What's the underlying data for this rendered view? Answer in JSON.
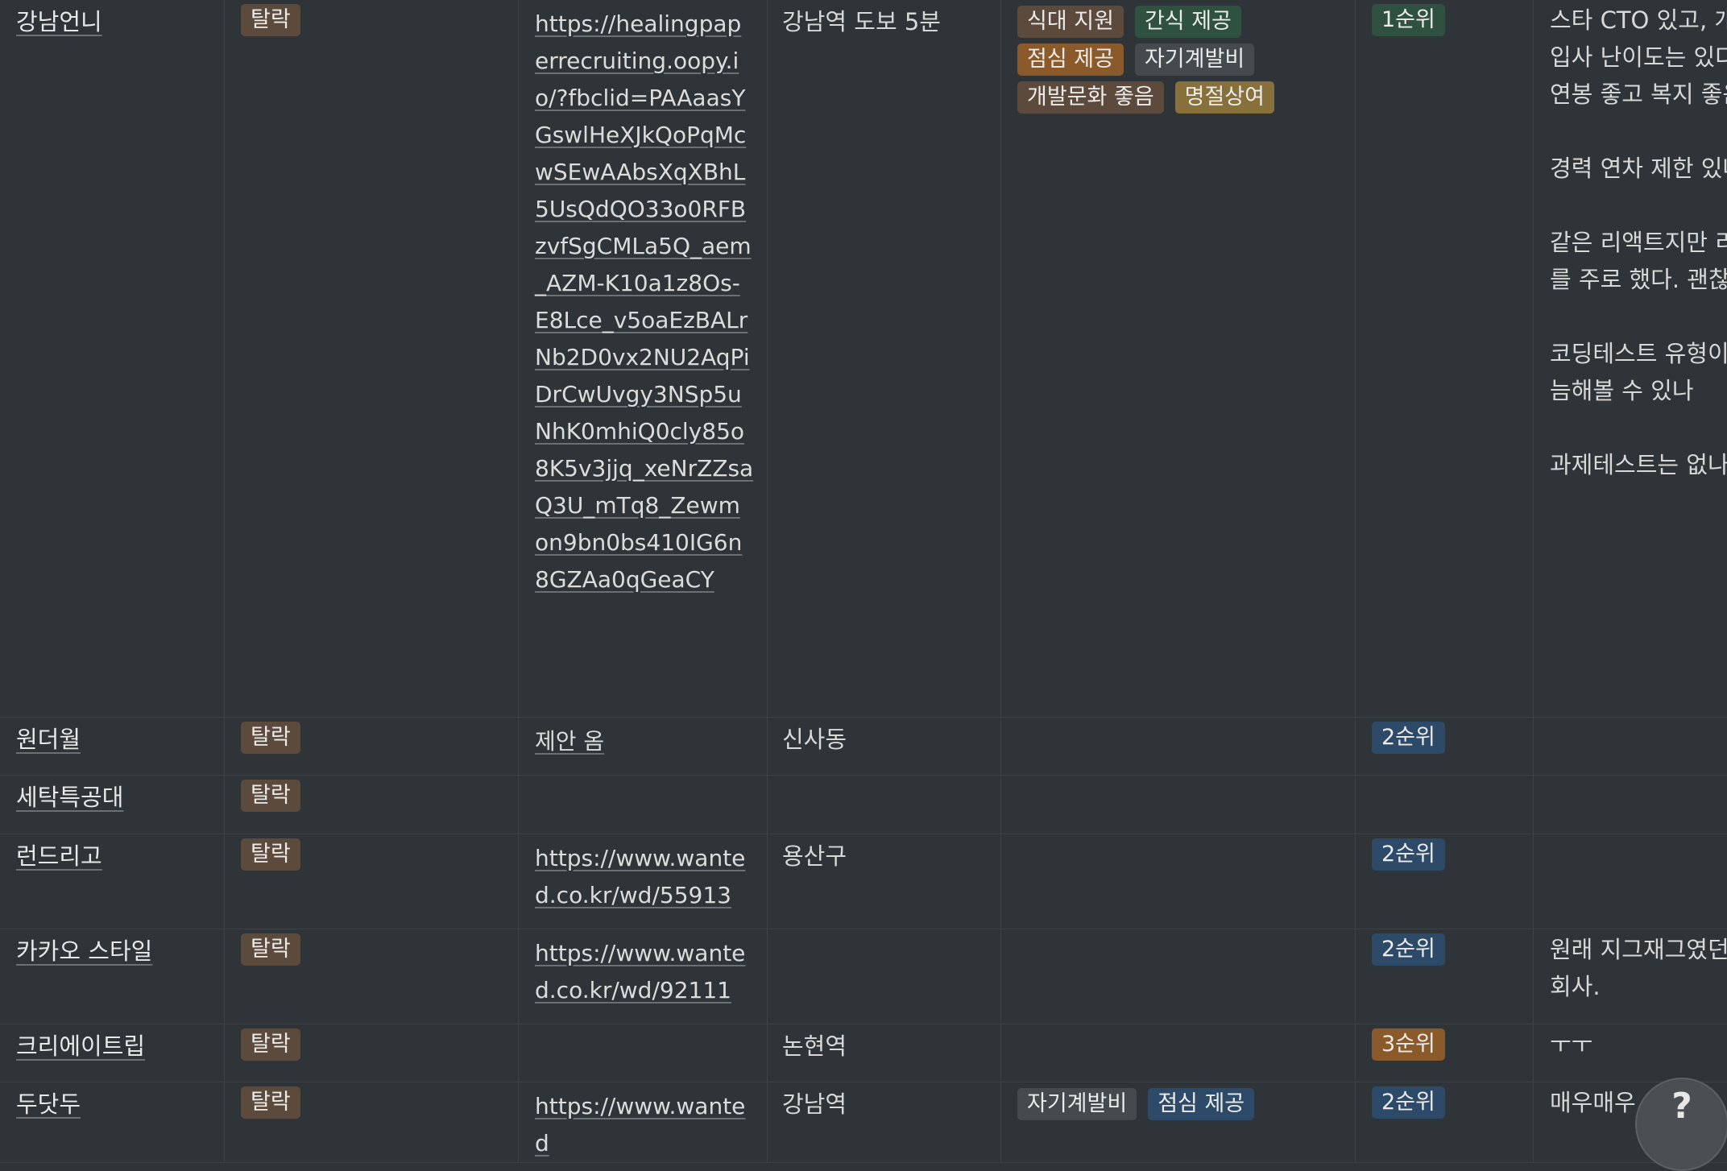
{
  "rows": [
    {
      "company": "강남언니",
      "status": {
        "label": "탈락",
        "color": "#5c4a3d"
      },
      "link": "https://healingpaperrecruiting.oopy.io/?fbclid=PAAaasYGswlHeXJkQoPqMcwSEwAAbsXqXBhL5UsQdQO33o0RFBzvfSgCMLa5Q_aem_AZM-K10a1z8Os-E8Lce_v5oaEzBALrNb2D0vx2NU2AqPiDrCwUvgy3NSp5uNhK0mhiQ0cly85o8K5v3jjq_xeNrZZsaQ3U_mTq8_Zewmon9bn0bs410IG6n8GZAa0qGeaCY",
      "location": "강남역 도보 5분",
      "benefits": [
        {
          "label": "식대 지원",
          "color": "#5c4a3d"
        },
        {
          "label": "간식 제공",
          "color": "#2f5140"
        },
        {
          "label": "점심 제공",
          "color": "#8a5a2b"
        },
        {
          "label": "자기계발비",
          "color": "#454a4e"
        },
        {
          "label": "개발문화 좋음",
          "color": "#5c4a3d"
        },
        {
          "label": "명절상여",
          "color": "#88703a"
        }
      ],
      "priority": {
        "label": "1순위",
        "color": "#2f5140"
      },
      "memo": "스타 CTO 있고, 개\n입사 난이도는 있다\n연봉 좋고 복지 좋음\n\n경력 연차 제한 있나\n\n같은 리액트지만 리\n를 주로 했다. 괜찮\n\n코딩테스트 유형이\n늠해볼 수 있나\n\n과제테스트는 없나"
    },
    {
      "company": "원더월",
      "status": {
        "label": "탈락",
        "color": "#5c4a3d"
      },
      "link": "제안 옴",
      "location": "신사동",
      "benefits": [],
      "priority": {
        "label": "2순위",
        "color": "#2d4a68"
      },
      "memo": ""
    },
    {
      "company": "세탁특공대",
      "status": {
        "label": "탈락",
        "color": "#5c4a3d"
      },
      "link": "",
      "location": "",
      "benefits": [],
      "priority": {
        "label": "",
        "color": ""
      },
      "memo": ""
    },
    {
      "company": "런드리고",
      "status": {
        "label": "탈락",
        "color": "#5c4a3d"
      },
      "link": "https://www.wanted.co.kr/wd/55913",
      "location": "용산구",
      "benefits": [],
      "priority": {
        "label": "2순위",
        "color": "#2d4a68"
      },
      "memo": ""
    },
    {
      "company": "카카오 스타일",
      "status": {
        "label": "탈락",
        "color": "#5c4a3d"
      },
      "link": "https://www.wanted.co.kr/wd/92111",
      "location": "",
      "benefits": [],
      "priority": {
        "label": "2순위",
        "color": "#2d4a68"
      },
      "memo": "원래 지그재그였던\n회사."
    },
    {
      "company": "크리에이트립",
      "status": {
        "label": "탈락",
        "color": "#5c4a3d"
      },
      "link": "",
      "location": "논현역",
      "benefits": [],
      "priority": {
        "label": "3순위",
        "color": "#8a5a2b"
      },
      "memo": "ㅜㅜ"
    },
    {
      "company": "두닷두",
      "status": {
        "label": "탈락",
        "color": "#5c4a3d"
      },
      "link": "https://www.wanted",
      "location": "강남역",
      "benefits": [
        {
          "label": "자기계발비",
          "color": "#454a4e"
        },
        {
          "label": "점심 제공",
          "color": "#2d4a68"
        }
      ],
      "priority": {
        "label": "2순위",
        "color": "#2d4a68"
      },
      "memo": "매우매우"
    }
  ],
  "help_button": {
    "label": "?",
    "icon": "help-icon"
  }
}
